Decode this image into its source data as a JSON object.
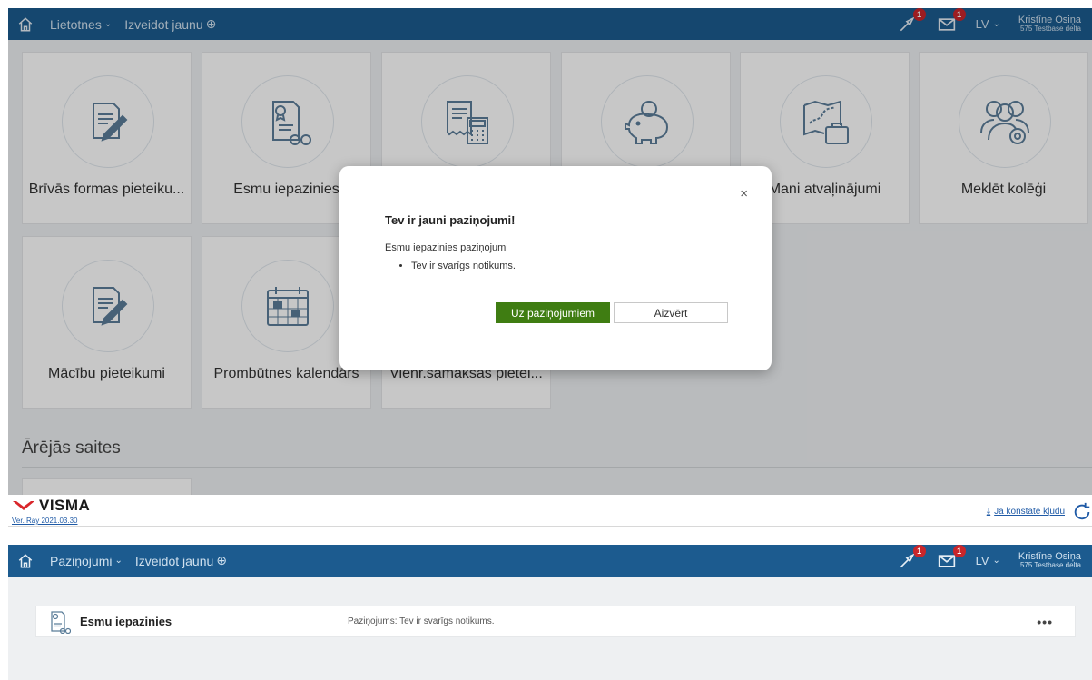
{
  "screen1": {
    "topbar": {
      "menu_label": "Lietotnes",
      "create_label": "Izveidot jaunu",
      "tasks_badge": "1",
      "messages_badge": "1",
      "language": "LV",
      "user_name": "Kristīne Osiņa",
      "user_company": "575 Testbase delta"
    },
    "tiles": [
      {
        "label": "Brīvās formas pieteiku...",
        "icon": "document-pen-icon"
      },
      {
        "label": "Esmu iepazinies",
        "icon": "certificate-glasses-icon"
      },
      {
        "label": "",
        "icon": "receipt-calculator-icon"
      },
      {
        "label": "",
        "icon": "piggy-bank-icon"
      },
      {
        "label": "Mani atvaļinājumi",
        "icon": "map-suitcase-icon"
      },
      {
        "label": "Meklēt kolēģi",
        "icon": "people-search-icon"
      },
      {
        "label": "Mācību pieteikumi",
        "icon": "document-pen-icon"
      },
      {
        "label": "Prombūtnes kalendārs",
        "icon": "calendar-icon"
      },
      {
        "label": "Vienr.samaksas pietei...",
        "icon": ""
      }
    ],
    "section_title": "Ārējās saites",
    "footer": {
      "brand": "VISMA",
      "version": "Ver. Ray 2021.03.30",
      "bug_link": "Ja konstatē kļūdu"
    },
    "modal": {
      "title": "Tev ir jauni paziņojumi!",
      "section": "Esmu iepazinies paziņojumi",
      "items": [
        "Tev ir svarīgs notikums."
      ],
      "primary_button": "Uz paziņojumiem",
      "secondary_button": "Aizvērt"
    },
    "colors": {
      "topbar": "#1c5b8f",
      "primary": "#3f7d12",
      "badge": "#c9262b"
    }
  },
  "screen2": {
    "topbar": {
      "menu_label": "Paziņojumi",
      "create_label": "Izveidot jaunu",
      "tasks_badge": "1",
      "messages_badge": "1",
      "language": "LV",
      "user_name": "Kristīne Osiņa",
      "user_company": "575 Testbase delta"
    },
    "notification": {
      "title": "Esmu iepazinies",
      "text": "Paziņojums: Tev ir svarīgs notikums.",
      "more": "•••"
    }
  }
}
